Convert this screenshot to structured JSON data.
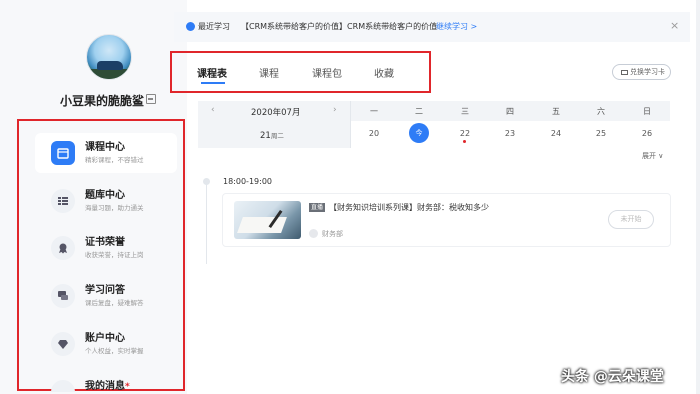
{
  "sidebar": {
    "username": "小豆果的脆脆鲨",
    "items": [
      {
        "label": "课程中心",
        "sub": "精彩课程，不容错过",
        "icon": "calendar-icon",
        "active": true
      },
      {
        "label": "题库中心",
        "sub": "海量习题，助力通关",
        "icon": "list-icon",
        "active": false
      },
      {
        "label": "证书荣誉",
        "sub": "收获荣誉，持证上岗",
        "icon": "certificate-icon",
        "active": false
      },
      {
        "label": "学习问答",
        "sub": "课后复盘，疑难解答",
        "icon": "chat-icon",
        "active": false
      },
      {
        "label": "账户中心",
        "sub": "个人权益，实时掌握",
        "icon": "diamond-icon",
        "active": false
      },
      {
        "label": "我的消息",
        "sub": "",
        "icon": "bell-icon",
        "active": false
      }
    ]
  },
  "topbar": {
    "label": "最近学习",
    "text": "【CRM系统带给客户的价值】CRM系统带给客户的价值",
    "link": "继续学习 >",
    "close": "×"
  },
  "tabs": [
    "课程表",
    "课程",
    "课程包",
    "收藏"
  ],
  "redeem_button": "兑换学习卡",
  "calendar": {
    "month": "2020年07月",
    "today_day": "21",
    "today_weekday": "周二",
    "weekdays": [
      "一",
      "二",
      "三",
      "四",
      "五",
      "六",
      "日"
    ],
    "dates": [
      "20",
      "今",
      "22",
      "23",
      "24",
      "25",
      "26"
    ],
    "expand": "展开 ∨"
  },
  "schedule": {
    "time": "18:00-19:00",
    "course": {
      "badge": "直播",
      "title": "【财务知识培训系列课】财务部：税收知多少",
      "teacher": "财务部",
      "status": "未开始"
    }
  },
  "watermark": "头条 @云朵课堂"
}
